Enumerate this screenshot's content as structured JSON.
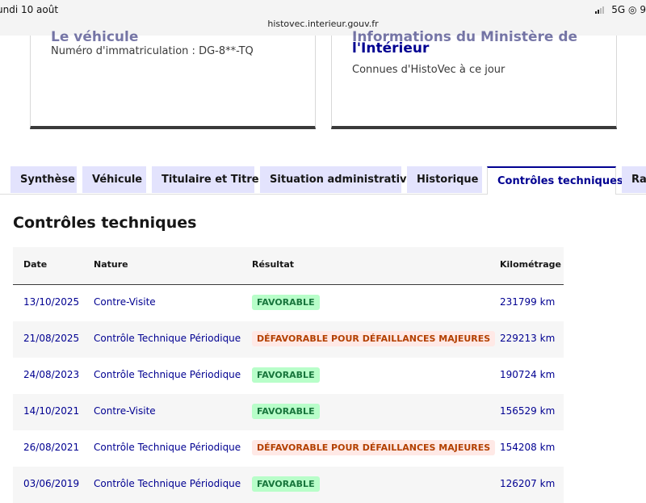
{
  "status_bar": {
    "time": "undi 10 août",
    "url": "histovec.interieur.gouv.fr",
    "network": "5G",
    "battery": "9"
  },
  "cards": {
    "left": {
      "clipped_title": "Le véhicule",
      "text": "Numéro d'immatriculation : DG-8**-TQ"
    },
    "right": {
      "clipped_title": "Informations du Ministère de",
      "title_line2": "l'Intérieur",
      "text": "Connues d'HistoVec à ce jour"
    }
  },
  "tabs": [
    {
      "label": "Synthèse"
    },
    {
      "label": "Véhicule"
    },
    {
      "label": "Titulaire et Titre"
    },
    {
      "label": "Situation administrative"
    },
    {
      "label": "Historique"
    },
    {
      "label": "Contrôles techniques"
    },
    {
      "label": "Rap"
    }
  ],
  "section_title": "Contrôles techniques",
  "table": {
    "headers": {
      "date": "Date",
      "nature": "Nature",
      "resultat": "Résultat",
      "kilometrage": "Kilométrage"
    },
    "rows": [
      {
        "date": "13/10/2025",
        "nature": "Contre-Visite",
        "resultat": "FAVORABLE",
        "status": "favorable",
        "km": "231799 km"
      },
      {
        "date": "21/08/2025",
        "nature": "Contrôle Technique Périodique",
        "resultat": "DÉFAVORABLE POUR DÉFAILLANCES MAJEURES",
        "status": "defavorable",
        "km": "229213 km"
      },
      {
        "date": "24/08/2023",
        "nature": "Contrôle Technique Périodique",
        "resultat": "FAVORABLE",
        "status": "favorable",
        "km": "190724 km"
      },
      {
        "date": "14/10/2021",
        "nature": "Contre-Visite",
        "resultat": "FAVORABLE",
        "status": "favorable",
        "km": "156529 km"
      },
      {
        "date": "26/08/2021",
        "nature": "Contrôle Technique Périodique",
        "resultat": "DÉFAVORABLE POUR DÉFAILLANCES MAJEURES",
        "status": "defavorable",
        "km": "154208 km"
      },
      {
        "date": "03/06/2019",
        "nature": "Contrôle Technique Périodique",
        "resultat": "FAVORABLE",
        "status": "favorable",
        "km": "126207 km"
      }
    ]
  },
  "colors": {
    "primary_blue": "#000091",
    "tab_bg": "#e3e3fd",
    "favorable_bg": "#b8fec9",
    "favorable_text": "#18753c",
    "defavorable_bg": "#ffe9e6",
    "defavorable_text": "#b34000"
  }
}
